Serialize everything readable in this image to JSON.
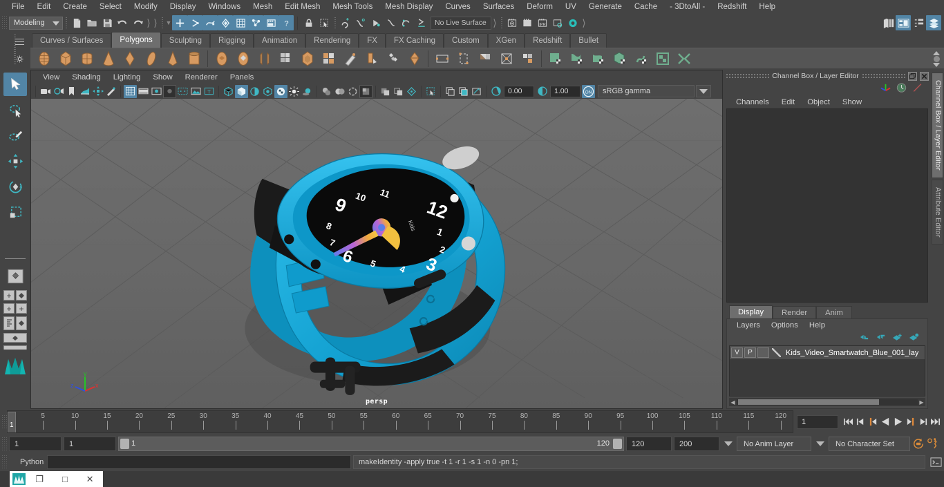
{
  "app": {
    "title": "Autodesk Maya",
    "menu_mode": "Modeling"
  },
  "menubar": {
    "items": [
      "File",
      "Edit",
      "Create",
      "Select",
      "Modify",
      "Display",
      "Windows",
      "Mesh",
      "Edit Mesh",
      "Mesh Tools",
      "Mesh Display",
      "Curves",
      "Surfaces",
      "Deform",
      "UV",
      "Generate",
      "Cache",
      "- 3DtoAll -",
      "Redshift",
      "Help"
    ]
  },
  "statusline": {
    "mode_label": "Modeling",
    "live_surface": "No Live Surface",
    "icons": [
      "new-scene-icon",
      "open-scene-icon",
      "save-scene-icon",
      "undo-icon",
      "redo-icon",
      "select-by-hierarchy-icon",
      "select-by-object-icon",
      "select-by-component-icon",
      "select-handle-icon",
      "select-misc-icon",
      "select-mask-icon",
      "select-render-icon",
      "lock-icon",
      "marquee-select-icon",
      "snap-grid-icon",
      "snap-curve-icon",
      "snap-point-icon",
      "snap-projected-icon",
      "snap-view-plane-icon",
      "render-current-frame-icon",
      "render-sequence-icon",
      "ipr-render-icon",
      "render-settings-icon",
      "hypershade-icon"
    ],
    "right_icons": [
      "show-hide-editors-icon",
      "attribute-editor-toggle-icon",
      "tool-settings-toggle-icon",
      "channel-box-toggle-icon"
    ]
  },
  "shelf": {
    "tabs": [
      "Curves / Surfaces",
      "Polygons",
      "Sculpting",
      "Rigging",
      "Animation",
      "Rendering",
      "FX",
      "FX Caching",
      "Custom",
      "XGen",
      "Redshift",
      "Bullet"
    ],
    "active_tab": "Polygons",
    "icon_names": [
      "poly-sphere-icon",
      "poly-cube-icon",
      "poly-cylinder-icon",
      "poly-cone-icon",
      "poly-torus-icon",
      "poly-plane-icon",
      "poly-pyramid-icon",
      "poly-pipe-icon",
      "poly-soccer-ball-icon",
      "poly-platonic-icon",
      "poly-prism-icon",
      "poly-helix-icon",
      "poly-gear-icon",
      "sculpt-sphere-icon",
      "combine-icon",
      "separate-icon",
      "boolean-icon",
      "extrude-icon",
      "bevel-icon",
      "bridge-icon",
      "merge-icon",
      "smooth-icon",
      "mirror-icon",
      "reduce-icon",
      "uv-editor-icon",
      "uv-auto-icon",
      "uv-planar-icon",
      "uv-cylindrical-icon",
      "uv-spherical-icon",
      "uv-layout-icon",
      "uv-unfold-icon"
    ]
  },
  "toolbox": {
    "items": [
      "select-tool",
      "lasso-select-tool",
      "paint-select-tool",
      "move-tool",
      "rotate-tool",
      "scale-tool",
      "last-tool-used",
      "quick-layout-single",
      "quick-layout-four-view",
      "quick-layout-persp-outliner",
      "quick-layout-persp-graph",
      "quick-layout-hypershade",
      "quick-layout-persp-uv",
      "maya-logo-icon"
    ],
    "selected": "select-tool"
  },
  "viewport": {
    "menus": [
      "View",
      "Shading",
      "Lighting",
      "Show",
      "Renderer",
      "Panels"
    ],
    "camera_label": "persp",
    "exposure": "0.00",
    "gamma": "1.00",
    "color_space": "sRGB gamma",
    "gamma_toggle": "ON",
    "axis_labels": {
      "x": "x",
      "y": "y",
      "z": "z"
    },
    "toolbar_icons": [
      "select-camera-icon",
      "camera-attributes-icon",
      "bookmark-icon",
      "image-plane-icon",
      "2d-pan-zoom-icon",
      "grease-pencil-icon",
      "grid-toggle-icon",
      "film-gate-icon",
      "resolution-gate-icon",
      "gate-mask-icon",
      "film-origin-icon",
      "exposure-icon",
      "title-safe-icon",
      "wireframe-icon",
      "smooth-shade-icon",
      "shaded-wireframe-icon",
      "hardware-texturing-icon",
      "texture-toggle-icon",
      "lighting-toggle-icon",
      "shadows-icon",
      "screen-space-ao-icon",
      "motion-blur-icon",
      "multisample-icon",
      "depth-of-field-icon",
      "isolate-select-icon",
      "xray-icon",
      "xray-joints-icon",
      "xray-active-icon"
    ]
  },
  "channel_box": {
    "title": "Channel Box / Layer Editor",
    "menus": [
      "Channels",
      "Edit",
      "Object",
      "Show"
    ],
    "window_buttons": [
      "restore-icon",
      "close-icon"
    ],
    "tool_icons": [
      "axis-gizmo-icon",
      "clock-icon",
      "slash-icon"
    ]
  },
  "layer_editor": {
    "tabs": [
      "Display",
      "Render",
      "Anim"
    ],
    "active_tab": "Display",
    "menus": [
      "Layers",
      "Options",
      "Help"
    ],
    "action_icons": [
      "move-layer-up-icon",
      "move-layer-down-icon",
      "new-layer-icon",
      "new-layer-from-selected-icon"
    ],
    "layers": [
      {
        "visibility": "V",
        "playback": "P",
        "type": "",
        "name": "Kids_Video_Smartwatch_Blue_001_lay"
      }
    ]
  },
  "right_tabs": [
    {
      "label": "Channel Box / Layer Editor",
      "active": true
    },
    {
      "label": "Attribute Editor",
      "active": false
    }
  ],
  "timeline": {
    "ticks": [
      5,
      10,
      15,
      20,
      25,
      30,
      35,
      40,
      45,
      50,
      55,
      60,
      65,
      70,
      75,
      80,
      85,
      90,
      95,
      100,
      105,
      110,
      115,
      120
    ],
    "start": 1,
    "end": 120,
    "current_frame": "1",
    "current_frame_marker": "1",
    "playback_buttons": [
      "go-to-start-icon",
      "step-back-keyframe-icon",
      "step-back-frame-icon",
      "play-backwards-icon",
      "play-forwards-icon",
      "step-forward-frame-icon",
      "step-forward-keyframe-icon",
      "go-to-end-icon"
    ]
  },
  "range_slider": {
    "anim_start": "1",
    "range_start": "1",
    "range_lo_label": "1",
    "range_hi_label": "120",
    "range_end": "120",
    "anim_end": "200",
    "anim_layer": "No Anim Layer",
    "character_set": "No Character Set",
    "right_icons": [
      "auto-key-icon",
      "animation-preferences-icon"
    ]
  },
  "command_line": {
    "language_label": "Python",
    "input_value": "",
    "output_value": "makeIdentity -apply true -t 1 -r 1 -s 1 -n 0 -pn 1;",
    "script_editor_icon": "script-editor-icon"
  },
  "taskbar": {
    "buttons": [
      "app-icon",
      "restore-window",
      "maximize-window",
      "close-window"
    ],
    "restore_glyph": "❐",
    "maximize_glyph": "□",
    "close_glyph": "✕"
  },
  "colors": {
    "accent": "#5285a6",
    "shelf_orange": "#d79a61",
    "shelf_green": "#6fae8e",
    "watch_blue": "#1fa8d8",
    "watch_black": "#1a1a1a",
    "panel_bg": "#444444",
    "viewport_bg": "#666666",
    "orange": "#d98b3a"
  },
  "scene": {
    "object_name": "Kids_Video_Smartwatch_Blue_001",
    "watch_face_numbers": [
      "12",
      "1",
      "2",
      "3",
      "4",
      "5",
      "6",
      "7",
      "8",
      "9",
      "10",
      "11"
    ],
    "brand_text": "Kids"
  }
}
